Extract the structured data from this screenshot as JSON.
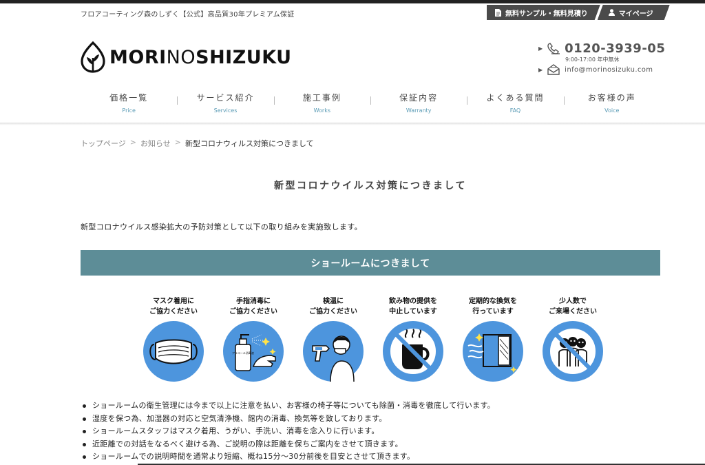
{
  "header": {
    "tagline": "フロアコーティング森のしずく【公式】高品質30年プレミアム保証",
    "sample_button": "無料サンプル・無料見積り",
    "mypage_button": "マイページ",
    "logo_text_1": "MORI",
    "logo_text_2": "NO",
    "logo_text_3": "SHIZUKU",
    "phone": "0120-3939-05",
    "hours": "9:00-17:00 年中無休",
    "email": "info@morinosizuku.com"
  },
  "nav": [
    {
      "jp": "価格一覧",
      "en": "Price"
    },
    {
      "jp": "サービス紹介",
      "en": "Services"
    },
    {
      "jp": "施工事例",
      "en": "Works"
    },
    {
      "jp": "保証内容",
      "en": "Warranty"
    },
    {
      "jp": "よくある質問",
      "en": "FAQ"
    },
    {
      "jp": "お客様の声",
      "en": "Voice"
    }
  ],
  "breadcrumb": {
    "home": "トップページ",
    "news": "お知らせ",
    "current": "新型コロナウィルス対策につきまして",
    "sep": ">"
  },
  "page_title": "新型コロナウイルス対策につきまして",
  "intro": "新型コロナウイルス感染拡大の予防対策として以下の取り組みを実施致します。",
  "section_title": "ショールームにつきまして",
  "icons": [
    {
      "line1": "マスク着用に",
      "line2": "ご協力ください",
      "icon": "mask-icon"
    },
    {
      "line1": "手指消毒に",
      "line2": "ご協力ください",
      "icon": "sanitizer-icon",
      "bottle_label": "アルコール消毒液"
    },
    {
      "line1": "検温に",
      "line2": "ご協力ください",
      "icon": "thermometer-icon"
    },
    {
      "line1": "飲み物の提供を",
      "line2": "中止しています",
      "icon": "no-drinks-icon"
    },
    {
      "line1": "定期的な換気を",
      "line2": "行っています",
      "icon": "ventilation-icon"
    },
    {
      "line1": "少人数で",
      "line2": "ご来場ください",
      "icon": "no-crowd-icon"
    }
  ],
  "bullets": [
    "ショールームの衛生管理には今まで以上に注意を払い、お客様の椅子等についても除菌・消毒を徹底して行います。",
    "湿度を保つ為、加湿器の対応と空気清浄機、館内の消毒、換気等を致しております。",
    "ショールームスタッフはマスク着用、うがい、手洗い、消毒を念入りに行います。",
    "近距離での対話をなるべく避ける為、ご説明の際は距離を保ちご案内をさせて頂きます。",
    "ショールームでの説明時間を通常より短縮、概ね15分～30分前後を目安とさせて頂きます。"
  ],
  "colors": {
    "section_bar": "#5d8d97",
    "icon_circle": "#4d95dd",
    "nav_en": "#5a9bb5"
  }
}
